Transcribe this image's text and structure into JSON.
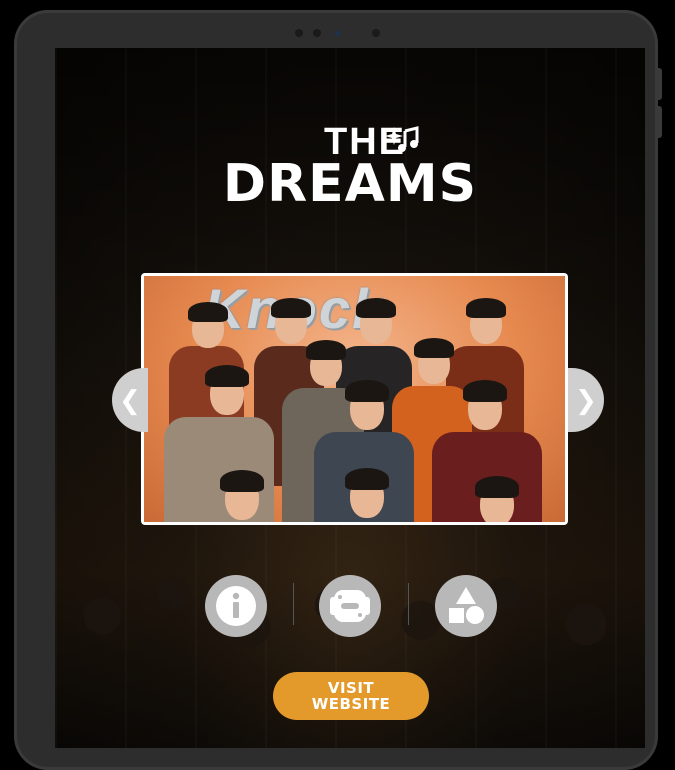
{
  "logo": {
    "line1": "THE",
    "line2": "DREAMS"
  },
  "carousel": {
    "poster_title": "Knock",
    "prev_symbol": "❮",
    "next_symbol": "❯"
  },
  "actions": {
    "info_icon": "info-icon",
    "shapes_icon": "shapes-icon",
    "game_icon": "gamepad-icon"
  },
  "visit_button": {
    "line1": "VISIT",
    "line2": "WEBSITE"
  },
  "colors": {
    "accent": "#e39a2b",
    "icon_bg": "#b8b8b8",
    "poster_bg": "#e6894f"
  }
}
